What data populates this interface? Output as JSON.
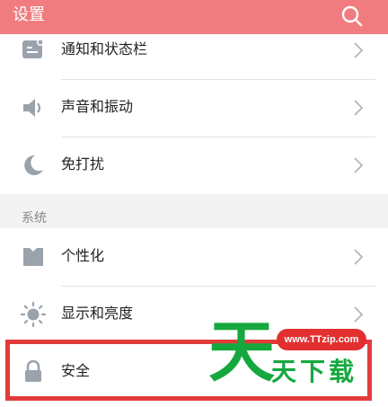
{
  "header": {
    "title": "设置"
  },
  "groups": {
    "first": [
      {
        "label": "通知和状态栏",
        "icon": "notification-icon"
      },
      {
        "label": "声音和振动",
        "icon": "speaker-icon"
      },
      {
        "label": "免打扰",
        "icon": "moon-icon"
      }
    ],
    "second_title": "系统",
    "second": [
      {
        "label": "个性化",
        "icon": "shirt-icon"
      },
      {
        "label": "显示和亮度",
        "icon": "brightness-icon"
      },
      {
        "label": "安全",
        "icon": "lock-icon"
      }
    ]
  },
  "watermark": {
    "url": "www.TTzip.com",
    "big_char": "天",
    "text": "天下载"
  },
  "colors": {
    "header": "#f07c7f",
    "icon": "#9aa3ac",
    "highlight": "#e23b3b",
    "watermark_green": "#15a83e"
  }
}
